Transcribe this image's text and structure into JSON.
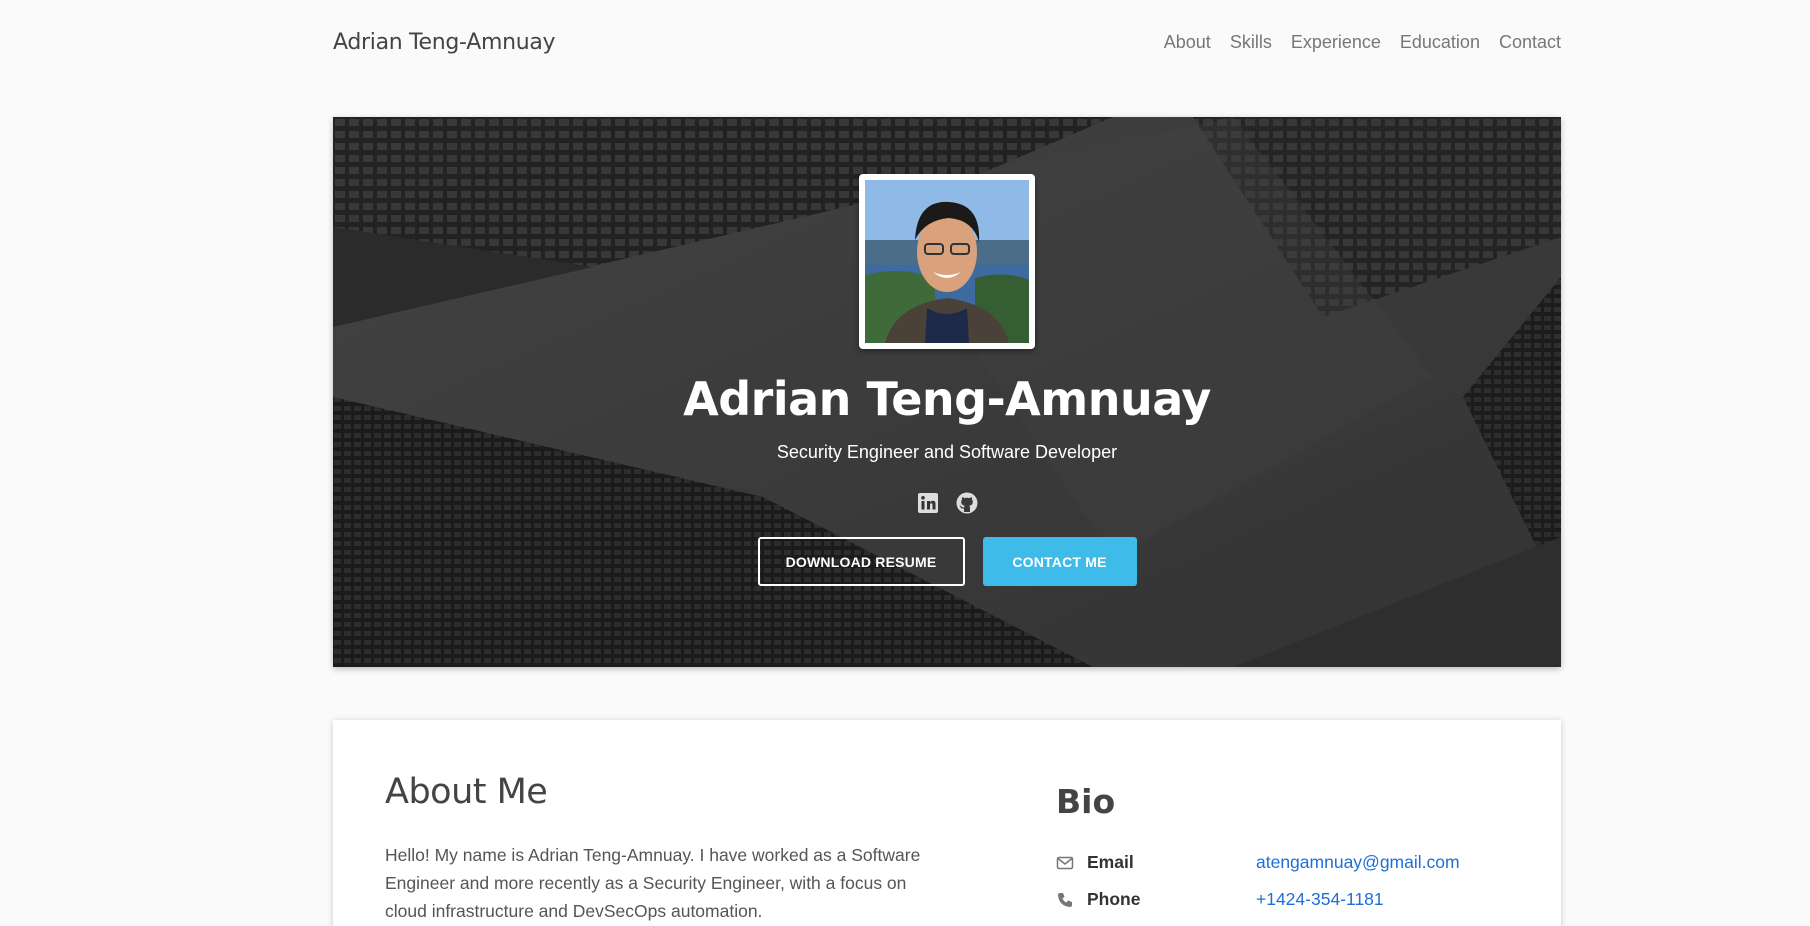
{
  "navbar": {
    "brand": "Adrian Teng-Amnuay",
    "links": [
      "About",
      "Skills",
      "Experience",
      "Education",
      "Contact"
    ]
  },
  "hero": {
    "name": "Adrian Teng-Amnuay",
    "title": "Security Engineer and Software Developer",
    "socials": [
      "linkedin-icon",
      "github-icon"
    ],
    "download_label": "DOWNLOAD RESUME",
    "contact_label": "CONTACT ME",
    "accent": "#3fbbe9"
  },
  "about": {
    "heading": "About Me",
    "text": "Hello! My name is Adrian Teng-Amnuay. I have worked as a Software Engineer and more recently as a Security Engineer, with a focus on cloud infrastructure and DevSecOps automation."
  },
  "bio": {
    "heading": "Bio",
    "rows": [
      {
        "icon": "envelope-icon",
        "label": "Email",
        "value": "atengamnuay@gmail.com"
      },
      {
        "icon": "phone-icon",
        "label": "Phone",
        "value": "+1424-354-1181"
      }
    ],
    "link_color": "#1e6fd9"
  }
}
